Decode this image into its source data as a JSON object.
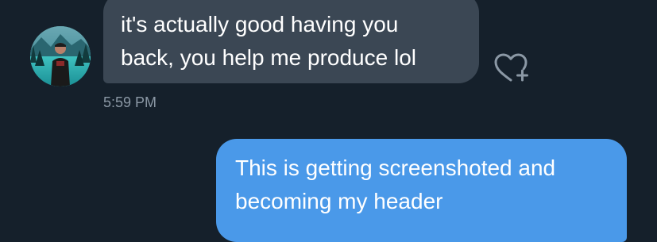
{
  "conversation": {
    "incoming_message": {
      "lines": [
        "it's actually good having you",
        "back, you help me produce lol"
      ],
      "timestamp": "5:59 PM"
    },
    "outgoing_message": {
      "lines": [
        "This is getting screenshoted and",
        "becoming my header"
      ]
    },
    "icons": {
      "avatar": "avatar",
      "like": "heart-plus-icon"
    },
    "colors": {
      "background": "#15202b",
      "incoming_bubble": "#3b4754",
      "outgoing_bubble": "#4a99e9",
      "timestamp": "#8b98a5"
    }
  }
}
